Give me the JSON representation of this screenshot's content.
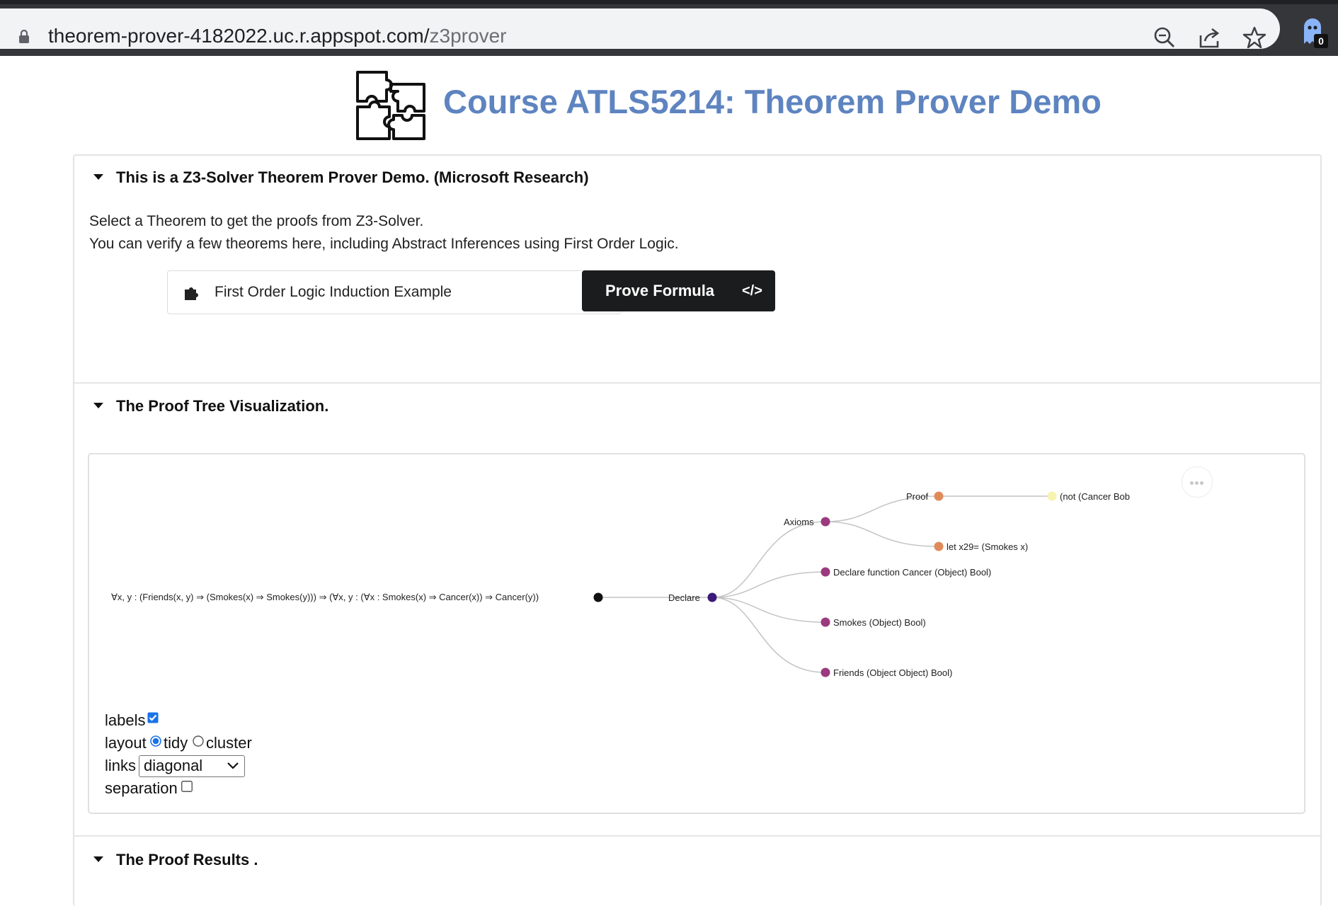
{
  "browser": {
    "url_host": "theorem-prover-4182022.uc.r.appspot.com/",
    "url_path": "z3prover",
    "extension_badge": "0"
  },
  "header": {
    "title": "Course ATLS5214: Theorem Prover Demo"
  },
  "intro_section": {
    "heading": "This is a Z3-Solver Theorem Prover Demo. (Microsoft Research)",
    "line1": "Select a Theorem to get the proofs from Z3-Solver.",
    "line2": "You can verify a few theorems here, including Abstract Inferences using First Order Logic.",
    "selected_theorem": "First Order Logic Induction Example",
    "prove_button": "Prove Formula",
    "prove_button_icon": "</>"
  },
  "tree_section": {
    "heading": "The Proof Tree Visualization.",
    "nodes": {
      "root": "∀x, y : (Friends(x, y) ⇒ (Smokes(x) ⇒ Smokes(y)))  ⇒ (∀x, y : (∀x : Smokes(x) ⇒ Cancer(x)) ⇒ Cancer(y))",
      "declare": "Declare",
      "axioms": "Axioms",
      "proof": "Proof",
      "not_cancer": "(not (Cancer Bob",
      "let_x29": "let x29= (Smokes x)",
      "decl_cancer": "Declare function Cancer (Object) Bool)",
      "smokes": "Smokes (Object) Bool)",
      "friends": "Friends (Object Object) Bool)"
    },
    "node_colors": {
      "root": "#111111",
      "declare": "#3b1a7a",
      "inner": "#9b3a7e",
      "proof": "#e08a5a",
      "leaf": "#f7f3b0"
    },
    "controls": {
      "labels_label": "labels",
      "labels_checked": true,
      "layout_label": "layout",
      "layout_tidy": "tidy",
      "layout_cluster": "cluster",
      "layout_selected": "tidy",
      "links_label": "links",
      "links_value": "diagonal",
      "separation_label": "separation",
      "separation_checked": false
    }
  },
  "results_section": {
    "heading": "The Proof Results ."
  }
}
